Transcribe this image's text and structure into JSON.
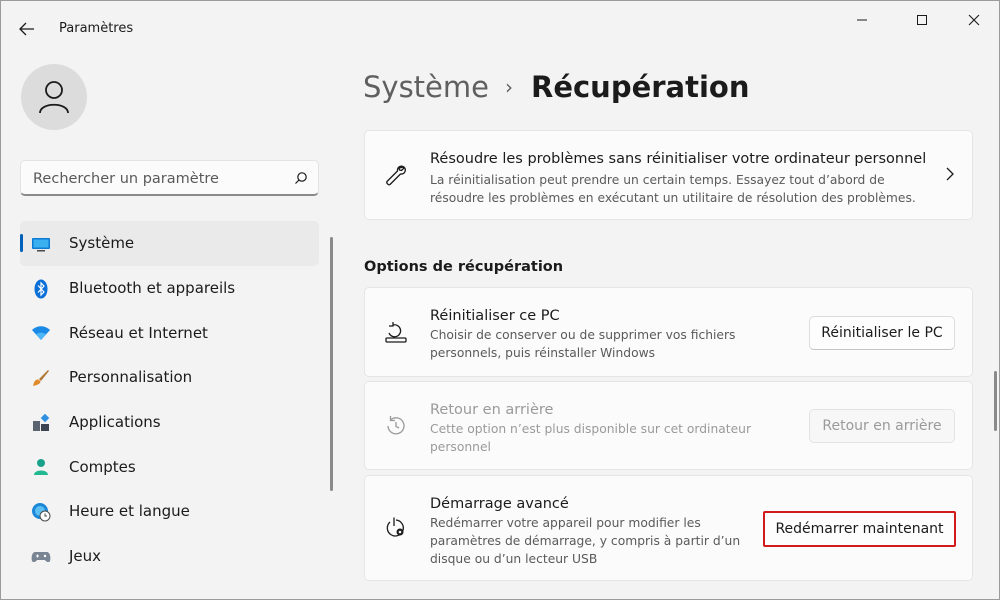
{
  "window": {
    "title": "Paramètres",
    "controls": [
      "minimize-icon",
      "maximize-icon",
      "close-icon"
    ]
  },
  "search": {
    "placeholder": "Rechercher un paramètre"
  },
  "sidebar": {
    "items": [
      {
        "label": "Système",
        "icon": "monitor-icon",
        "active": true
      },
      {
        "label": "Bluetooth et appareils",
        "icon": "bluetooth-icon"
      },
      {
        "label": "Réseau et Internet",
        "icon": "wifi-icon"
      },
      {
        "label": "Personnalisation",
        "icon": "brush-icon"
      },
      {
        "label": "Applications",
        "icon": "apps-icon"
      },
      {
        "label": "Comptes",
        "icon": "person-icon"
      },
      {
        "label": "Heure et langue",
        "icon": "globe-clock-icon"
      },
      {
        "label": "Jeux",
        "icon": "gamepad-icon"
      }
    ]
  },
  "breadcrumb": {
    "parent": "Système",
    "separator": "›",
    "current": "Récupération"
  },
  "troubleshoot": {
    "title": "Résoudre les problèmes sans réinitialiser votre ordinateur personnel",
    "desc_line1": "La réinitialisation peut prendre un certain temps. Essayez tout d’abord de",
    "desc_line2": "résoudre les problèmes en exécutant un utilitaire de résolution des problèmes."
  },
  "section": {
    "title": "Options de récupération"
  },
  "reset": {
    "title": "Réinitialiser ce PC",
    "desc_line1": "Choisir de conserver ou de supprimer vos fichiers",
    "desc_line2": "personnels, puis réinstaller Windows",
    "button": "Réinitialiser le PC"
  },
  "goback": {
    "title": "Retour en arrière",
    "desc_line1": "Cette option n’est plus disponible sur cet ordinateur",
    "desc_line2": "personnel",
    "button": "Retour en arrière"
  },
  "advanced": {
    "title": "Démarrage avancé",
    "desc_line1": "Redémarrer votre appareil pour modifier les",
    "desc_line2": "paramètres de démarrage, y compris à partir d’un",
    "desc_line3": "disque ou d’un lecteur USB",
    "button": "Redémarrer maintenant"
  },
  "colors": {
    "accent": "#005fb8",
    "highlight": "#d11a1a"
  }
}
